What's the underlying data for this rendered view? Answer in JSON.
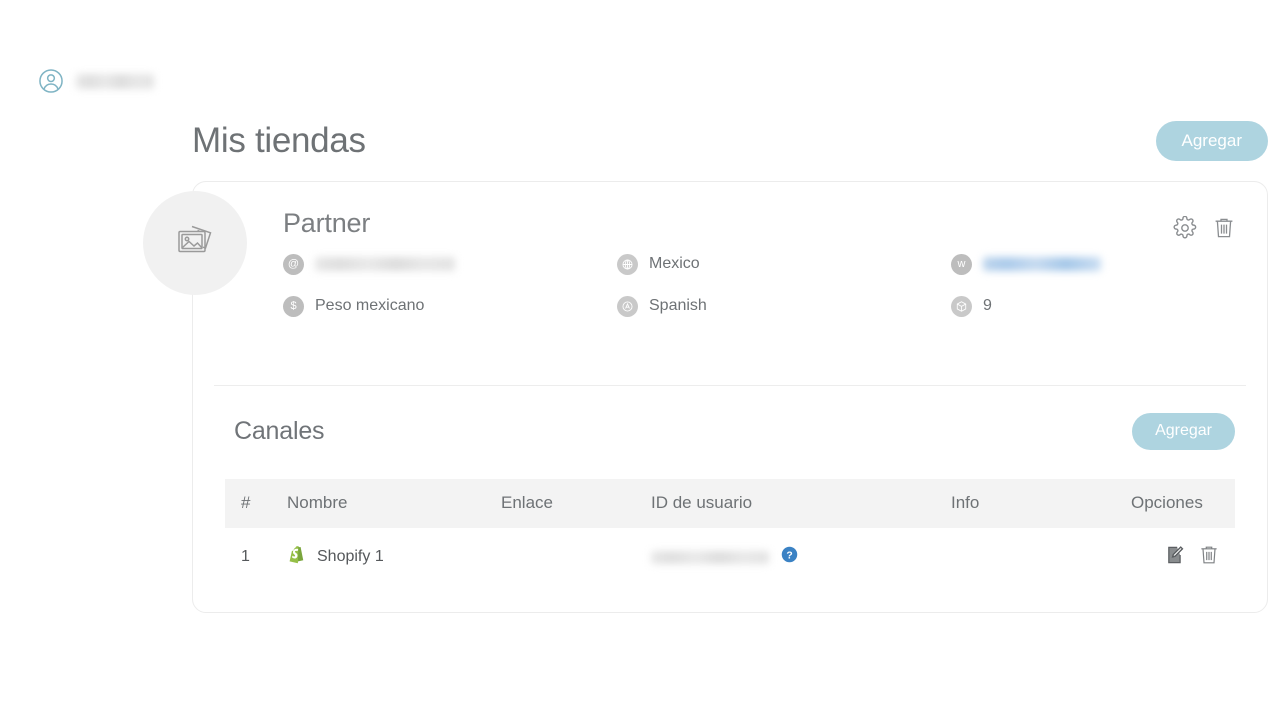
{
  "topbar": {
    "avatar_icon": "user-circle-icon",
    "username": "Partner"
  },
  "header": {
    "title": "Mis tiendas",
    "add_label": "Agregar"
  },
  "store": {
    "thumb_icon": "images-placeholder-icon",
    "name": "Partner",
    "meta": {
      "email_icon": "at-icon",
      "email": "partner@yuju.io",
      "country_icon": "globe-icon",
      "country": "Mexico",
      "website_icon": "web-icon",
      "website": "https://yuju.io",
      "currency_icon": "currency-icon",
      "currency": "Peso mexicano",
      "language_icon": "language-icon",
      "language": "Spanish",
      "products_icon": "package-icon",
      "products": "9"
    },
    "settings_icon": "gear-icon",
    "delete_icon": "trash-icon"
  },
  "channels": {
    "title": "Canales",
    "add_label": "Agregar",
    "columns": [
      "#",
      "Nombre",
      "Enlace",
      "ID de usuario",
      "Info",
      "Opciones"
    ],
    "rows": [
      {
        "num": "1",
        "platform_icon": "shopify-icon",
        "name": "Shopify 1",
        "link": "",
        "user_id": "yuju-certificat...",
        "info_icon": "help-circle-icon",
        "edit_icon": "edit-document-icon",
        "delete_icon": "trash-icon"
      }
    ]
  },
  "colors": {
    "accent": "#aed4e0",
    "text": "#6e7275",
    "link": "#3b82c4",
    "shopify_green": "#8db849",
    "table_header_bg": "#f3f3f3"
  }
}
